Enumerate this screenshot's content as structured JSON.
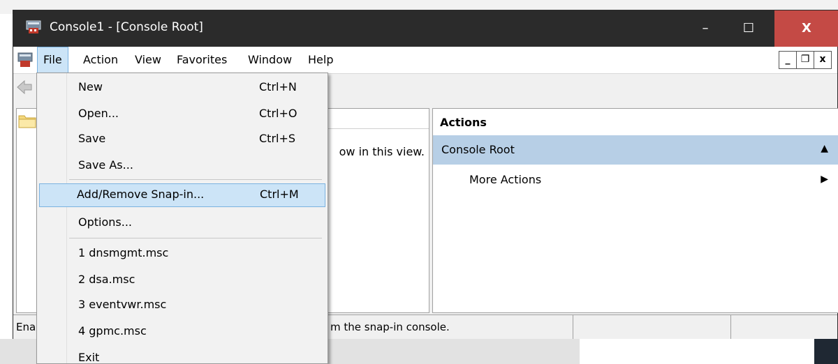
{
  "window": {
    "title": "Console1 - [Console Root]",
    "minimize": "–",
    "maximize": "☐",
    "close": "X"
  },
  "menubar": {
    "items": [
      "File",
      "Action",
      "View",
      "Favorites",
      "Window",
      "Help"
    ],
    "active": "File",
    "mdi_minimize": "_",
    "mdi_restore": "❐",
    "mdi_close": "x"
  },
  "center": {
    "empty_message": "ow in this view."
  },
  "actions": {
    "title": "Actions",
    "section": "Console Root",
    "section_arrow": "▲",
    "more_actions": "More Actions",
    "more_arrow": "▶"
  },
  "statusbar": {
    "left_text": "Ena",
    "main_text": "m the snap-in console."
  },
  "file_menu": {
    "items": [
      {
        "label": "New",
        "shortcut": "Ctrl+N"
      },
      {
        "label": "Open...",
        "shortcut": "Ctrl+O"
      },
      {
        "label": "Save",
        "shortcut": "Ctrl+S"
      },
      {
        "label": "Save As...",
        "shortcut": ""
      },
      {
        "label": "Add/Remove Snap-in...",
        "shortcut": "Ctrl+M"
      },
      {
        "label": "Options...",
        "shortcut": ""
      },
      {
        "label": "1 dnsmgmt.msc",
        "shortcut": ""
      },
      {
        "label": "2 dsa.msc",
        "shortcut": ""
      },
      {
        "label": "3 eventvwr.msc",
        "shortcut": ""
      },
      {
        "label": "4 gpmc.msc",
        "shortcut": ""
      },
      {
        "label": "Exit",
        "shortcut": ""
      }
    ],
    "highlighted": "Add/Remove Snap-in..."
  },
  "colors": {
    "titlebar": "#2b2b2b",
    "close_button": "#c44a45",
    "menu_highlight": "#cce4f7",
    "actions_section": "#b7cfe6"
  }
}
